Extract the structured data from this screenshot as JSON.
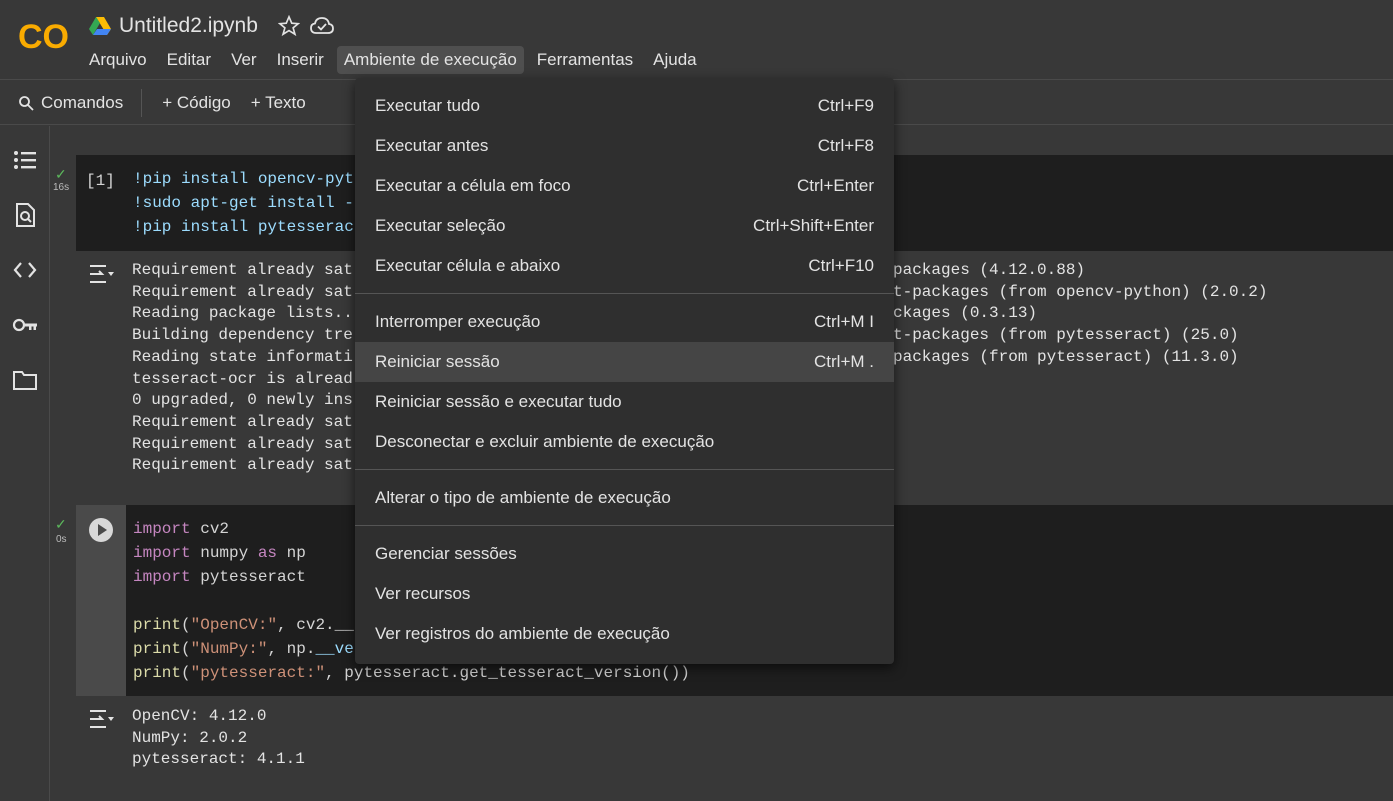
{
  "header": {
    "notebook_title": "Untitled2.ipynb",
    "menu": [
      "Arquivo",
      "Editar",
      "Ver",
      "Inserir",
      "Ambiente de execução",
      "Ferramentas",
      "Ajuda"
    ],
    "active_menu": "Ambiente de execução"
  },
  "toolbar": {
    "commands": "Comandos",
    "add_code": "+ Código",
    "add_text": "+ Texto"
  },
  "dropdown": {
    "items": [
      {
        "label": "Executar tudo",
        "shortcut": "Ctrl+F9"
      },
      {
        "label": "Executar antes",
        "shortcut": "Ctrl+F8"
      },
      {
        "label": "Executar a célula em foco",
        "shortcut": "Ctrl+Enter"
      },
      {
        "label": "Executar seleção",
        "shortcut": "Ctrl+Shift+Enter"
      },
      {
        "label": "Executar célula e abaixo",
        "shortcut": "Ctrl+F10"
      },
      {
        "label": "Interromper execução",
        "shortcut": "Ctrl+M I"
      },
      {
        "label": "Reiniciar sessão",
        "shortcut": "Ctrl+M ."
      },
      {
        "label": "Reiniciar sessão e executar tudo",
        "shortcut": ""
      },
      {
        "label": "Desconectar e excluir ambiente de execução",
        "shortcut": ""
      },
      {
        "label": "Alterar o tipo de ambiente de execução",
        "shortcut": ""
      },
      {
        "label": "Gerenciar sessões",
        "shortcut": ""
      },
      {
        "label": "Ver recursos",
        "shortcut": ""
      },
      {
        "label": "Ver registros do ambiente de execução",
        "shortcut": ""
      }
    ]
  },
  "cell1": {
    "exec_count": "[1]",
    "exec_time": "16s",
    "code": [
      "!pip install opencv-pyt",
      "!sudo apt-get install -",
      "!pip install pytesserac"
    ],
    "output": [
      "Requirement already sat",
      "Requirement already sat",
      "Reading package lists..",
      "Building dependency tre",
      "Reading state informati",
      "tesseract-ocr is alread",
      "0 upgraded, 0 newly ins",
      "Requirement already sat",
      "Requirement already sat",
      "Requirement already sat"
    ],
    "output_right": [
      "packages (4.12.0.88)",
      "t-packages (from opencv-python) (2.0.2)",
      "",
      "",
      "",
      "",
      "",
      "ckages (0.3.13)",
      "t-packages (from pytesseract) (25.0)",
      "packages (from pytesseract) (11.3.0)"
    ]
  },
  "cell2": {
    "exec_time": "0s",
    "output": [
      "OpenCV: 4.12.0",
      "NumPy: 2.0.2",
      "pytesseract: 4.1.1"
    ]
  }
}
